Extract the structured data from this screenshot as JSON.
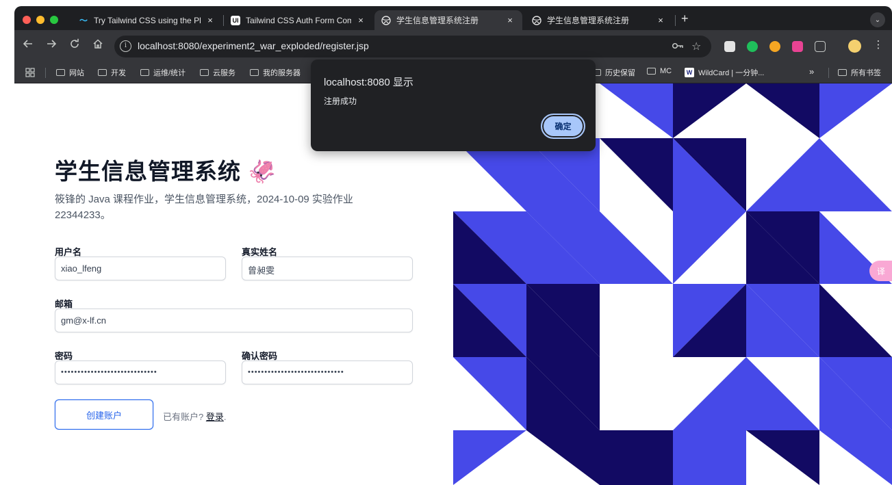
{
  "browser": {
    "tabs": [
      {
        "title": "Try Tailwind CSS using the Pl",
        "favicon": "tailwind-icon"
      },
      {
        "title": "Tailwind CSS Auth Form Com",
        "favicon": "ui-icon",
        "favicon_text": "UI"
      },
      {
        "title": "学生信息管理系统注册",
        "favicon": "globe-icon",
        "active": true
      },
      {
        "title": "学生信息管理系统注册",
        "favicon": "globe-icon"
      }
    ],
    "tab_close_glyph": "×",
    "new_tab_glyph": "+",
    "tab_menu_glyph": "⌄",
    "url_host": "localhost",
    "url_rest": ":8080/experiment2_war_exploded/register.jsp",
    "bookmarks": [
      "网站",
      "开发",
      "运维/统计",
      "云服务",
      "我的服务器",
      "历史保留",
      "MC",
      "WildCard | 一分钟...",
      "所有书签"
    ],
    "bookmarks_overflow": "»"
  },
  "page": {
    "title": "学生信息管理系统",
    "title_emoji": "🦑",
    "description": "筱锋的 Java 课程作业，学生信息管理系统，2024-10-09 实验作业 22344233。",
    "form": {
      "username_label": "用户名",
      "username_value": "xiao_lfeng",
      "realname_label": "真实姓名",
      "realname_value": "曾昶雯",
      "email_label": "邮箱",
      "email_value": "gm@x-lf.cn",
      "password_label": "密码",
      "password_value": "•••••••••••••••••••••••••••••",
      "confirm_label": "确认密码",
      "confirm_value": "•••••••••••••••••••••••••••••",
      "submit_label": "创建账户",
      "have_account_text": "已有账户?",
      "login_link": "登录",
      "login_suffix": "."
    },
    "translate_badge": "译"
  },
  "dialog": {
    "title": "localhost:8080 显示",
    "message": "注册成功",
    "ok_label": "确定"
  },
  "colors": {
    "art_blue": "#4649e8",
    "art_navy": "#120a63",
    "accent": "#2563eb"
  }
}
